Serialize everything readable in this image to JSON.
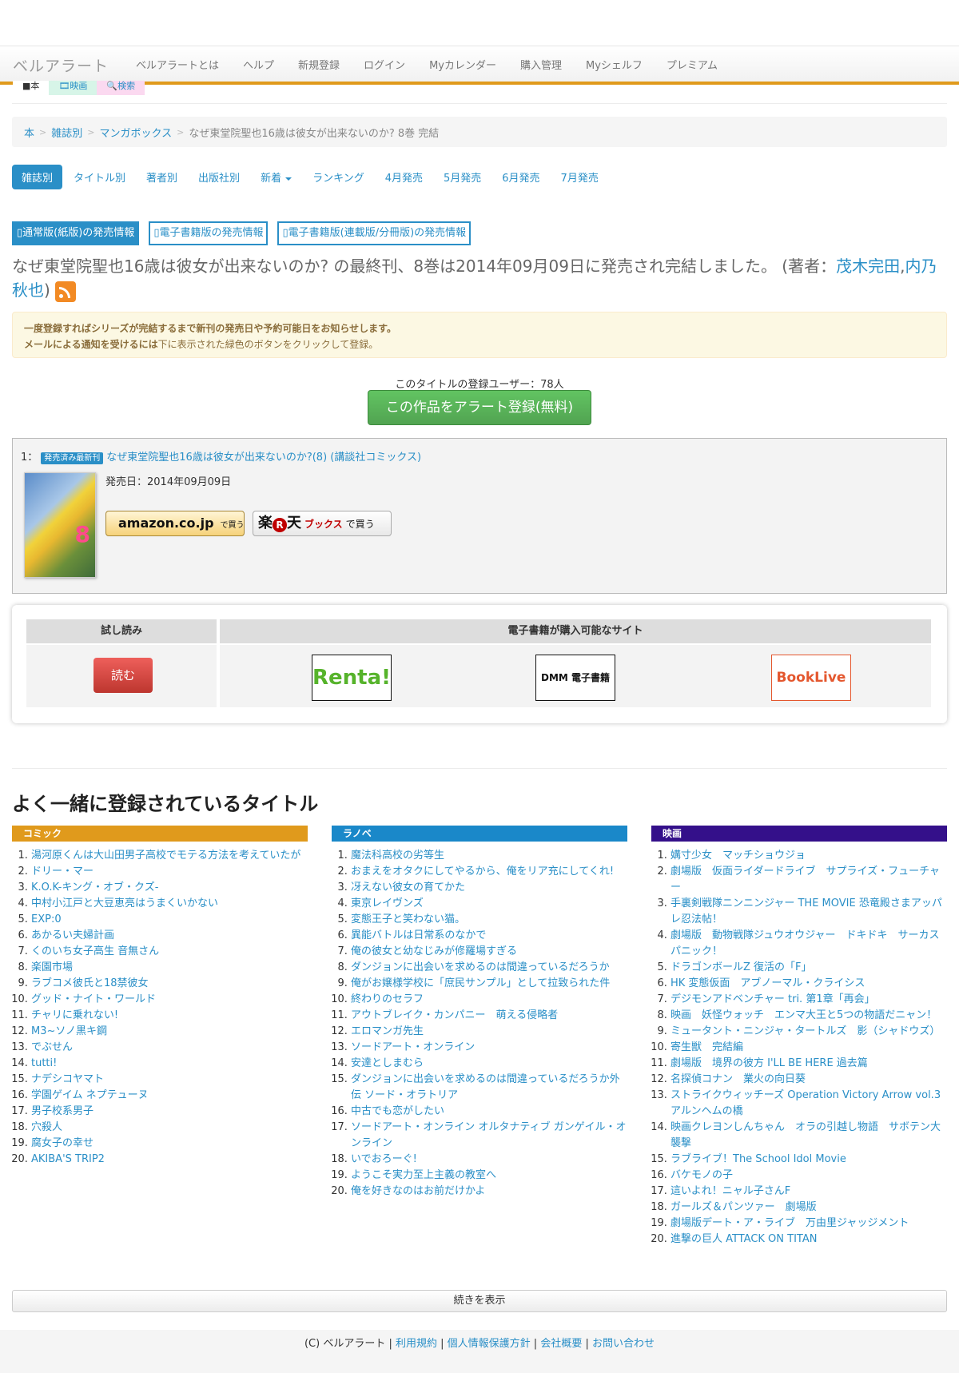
{
  "header": {
    "brand": "ベルアラート",
    "nav": [
      "ベルアラートとは",
      "ヘルプ",
      "新規登録",
      "ログイン",
      "Myカレンダー",
      "購入管理",
      "Myシェルフ",
      "プレミアム"
    ]
  },
  "tabs": {
    "book": "■本",
    "movie": "🎞映画",
    "search": "🔍検索"
  },
  "breadcrumb": {
    "items": [
      "本",
      "雑誌別",
      "マンガボックス"
    ],
    "sep": ">",
    "current": "なぜ東堂院聖也16歳は彼女が出来ないのか? 8巻 完結"
  },
  "subnav": {
    "items": [
      "雑誌別",
      "タイトル別",
      "著者別",
      "出版社別",
      "新着",
      "ランキング",
      "4月発売",
      "5月発売",
      "6月発売",
      "7月発売"
    ]
  },
  "release_buttons": [
    "通常版(紙版)の発売情報",
    "電子書籍版の発売情報",
    "電子書籍版(連載版/分冊版)の発売情報"
  ],
  "headline": {
    "text": "なぜ東堂院聖也16歳は彼女が出来ないのか? の最終刊、8巻は2014年09月09日に発売され完結しました。 (著者：",
    "author1": "茂木完田",
    "comma": ",",
    "author2": "内乃秋也",
    "close": ")"
  },
  "alert": {
    "line1": "一度登録すればシリーズが完結するまで新刊の発売日や予約可能日をお知らせします。",
    "line2_bold": "メールによる通知を受けるには",
    "line2_rest": "下に表示された緑色のボタンをクリックして登録。"
  },
  "register": {
    "user_count": "このタイトルの登録ユーザー：78人",
    "button": "この作品をアラート登録(無料)"
  },
  "item": {
    "index": "1：",
    "badge": "発売済み最新刊",
    "title": "なぜ東堂院聖也16歳は彼女が出来ないのか?(8) (講談社コミックス)",
    "cover_volume": "8",
    "release": "発売日：2014年09月09日",
    "amazon_logo": "amazon.co.jp",
    "amazon_suffix": "で買う",
    "rakuten_r": "R",
    "rakuten_left": "楽",
    "rakuten_right": "天",
    "rakuten_books": "ブックス",
    "rakuten_suffix": "で買う"
  },
  "ebook": {
    "col1_header": "試し読み",
    "col2_header": "電子書籍が購入可能なサイト",
    "read_button": "読む",
    "sites": [
      "Renta!",
      "DMM 電子書籍",
      "BookLive"
    ]
  },
  "related": {
    "title": "よく一緒に登録されているタイトル",
    "comic": {
      "label": "コミック",
      "items": [
        "湯河原くんは大山田男子高校でモテる方法を考えていたが",
        "ドリー・マー",
        "K.O.K-キング・オブ・クズ-",
        "中村小江戸と大豆恵亮はうまくいかない",
        "EXP:0",
        "あかるい夫婦計画",
        "くのいち女子高生 音無さん",
        "楽園市場",
        "ラブコメ彼氏と18禁彼女",
        "グッド・ナイト・ワールド",
        "チャリに乗れない!",
        "M3~ソノ黒キ鋼",
        "でぶせん",
        "tutti!",
        "ナデシコヤマト",
        "学園ゲイム ネプテューヌ",
        "男子校系男子",
        "穴殺人",
        "腐女子の幸せ",
        "AKIBA'S TRIP2"
      ]
    },
    "ranobe": {
      "label": "ラノベ",
      "items": [
        "魔法科高校の劣等生",
        "おまえをオタクにしてやるから、俺をリア充にしてくれ!",
        "冴えない彼女の育てかた",
        "東京レイヴンズ",
        "変態王子と笑わない猫。",
        "異能バトルは日常系のなかで",
        "俺の彼女と幼なじみが修羅場すぎる",
        "ダンジョンに出会いを求めるのは間違っているだろうか",
        "俺がお嬢様学校に「庶民サンプル」として拉致られた件",
        "終わりのセラフ",
        "アウトブレイク・カンパニー　萌える侵略者",
        "エロマンガ先生",
        "ソードアート・オンライン",
        "安達としまむら",
        "ダンジョンに出会いを求めるのは間違っているだろうか外伝 ソード・オラトリア",
        "中古でも恋がしたい",
        "ソードアート・オンライン オルタナティブ ガンゲイル・オンライン",
        "いでおろーぐ!",
        "ようこそ実力至上主義の教室へ",
        "俺を好きなのはお前だけかよ"
      ]
    },
    "movie": {
      "label": "映画",
      "items": [
        "媾寸少女　マッチショウジョ",
        "劇場版　仮面ライダードライブ　サプライズ・フューチャー",
        "手裏剣戦隊ニンニンジャー THE MOVIE 恐竜殿さまアッパレ忍法帖！",
        "劇場版　動物戦隊ジュウオウジャー　ドキドキ　サーカス　パニック！",
        "ドラゴンボールZ 復活の「F」",
        "HK 変態仮面　アブノーマル・クライシス",
        "デジモンアドベンチャー tri. 第1章「再会」",
        "映画　妖怪ウォッチ　エンマ大王と5つの物語だニャン！",
        "ミュータント・ニンジャ・タートルズ　影（シャドウズ）",
        "寄生獣　完結編",
        "劇場版　境界の彼方 I'LL BE HERE 過去篇",
        "名探偵コナン　業火の向日葵",
        "ストライクウィッチーズ Operation Victory Arrow vol.3 アルンヘムの橋",
        "映画クレヨンしんちゃん　オラの引越し物語　サボテン大襲撃",
        "ラブライブ！The School Idol Movie",
        "バケモノの子",
        "這いよれ！ニャル子さんF",
        "ガールズ＆パンツァー　劇場版",
        "劇場版デート・ア・ライブ　万由里ジャッジメント",
        "進撃の巨人 ATTACK ON TITAN"
      ]
    }
  },
  "more_button": "続きを表示",
  "footer": {
    "copyright": "(C) ベルアラート",
    "links": [
      "利用規約",
      "個人情報保護方針",
      "会社概要",
      "お問い合わせ"
    ],
    "sep": " | "
  },
  "colors": {
    "accent": "#e09a1c",
    "link": "#2a8fc7",
    "green": "#51a351",
    "red": "#bd362f",
    "movie": "#34108a"
  }
}
